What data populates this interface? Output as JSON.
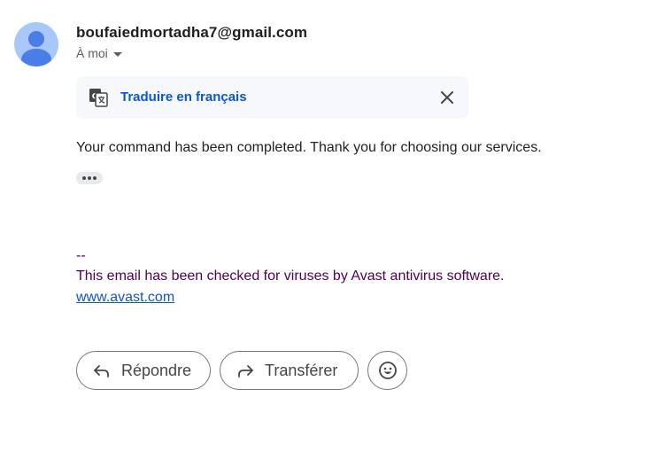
{
  "header": {
    "sender": "boufaiedmortadha7@gmail.com",
    "recipient": "À moi"
  },
  "translate": {
    "label": "Traduire en français"
  },
  "message": {
    "body": "Your command has been completed. Thank you for choosing our services."
  },
  "signature": {
    "separator": "--",
    "text": "This email has been checked for viruses by Avast antivirus software.",
    "link": "www.avast.com"
  },
  "actions": {
    "reply_label": "Répondre",
    "forward_label": "Transférer"
  },
  "icons": {
    "avatar": "person-icon",
    "recipient_toggle": "caret-down-icon",
    "translate": "translate-icon",
    "close": "close-icon",
    "more": "ellipsis-icon",
    "reply": "reply-icon",
    "forward": "forward-icon",
    "emoji": "emoji-icon"
  },
  "colors": {
    "link_blue": "#0b57d0",
    "signature_purple": "#500050",
    "avatar_bg": "#a8c7fa",
    "avatar_fg": "#4a7de8"
  }
}
